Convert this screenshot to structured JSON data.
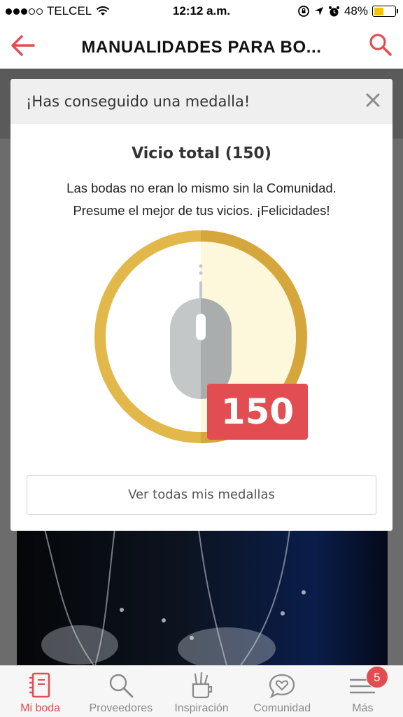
{
  "status_bar": {
    "carrier": "TELCEL",
    "time": "12:12 a.m.",
    "battery_percent": "48%",
    "battery_level": 0.48
  },
  "header": {
    "title": "MANUALIDADES PARA BO..."
  },
  "modal": {
    "title": "¡Has conseguido una medalla!",
    "medal_name": "Vicio total (150)",
    "description_line1": "Las bodas no eran lo mismo sin la Comunidad.",
    "description_line2": "Presume el mejor de tus vicios. ¡Felicidades!",
    "count": "150",
    "view_all_label": "Ver todas mis medallas"
  },
  "tabs": [
    {
      "label": "Mi boda",
      "icon": "notebook-icon",
      "active": true
    },
    {
      "label": "Proveedores",
      "icon": "search-icon",
      "active": false
    },
    {
      "label": "Inspiración",
      "icon": "inspiration-icon",
      "active": false
    },
    {
      "label": "Comunidad",
      "icon": "chat-heart-icon",
      "active": false
    },
    {
      "label": "Más",
      "icon": "menu-icon",
      "active": false,
      "badge": "5"
    }
  ],
  "colors": {
    "accent": "#e24d52",
    "medal_gold": "#e3b84a",
    "medal_light": "#fdf8dc"
  }
}
